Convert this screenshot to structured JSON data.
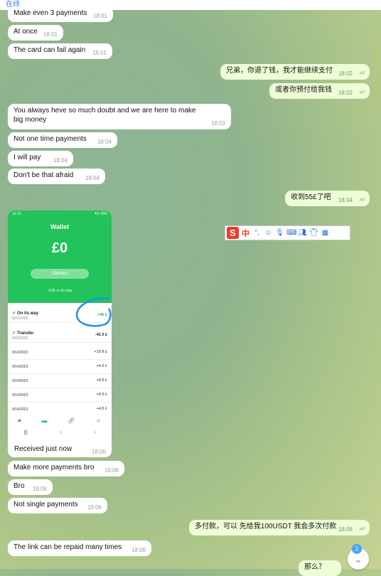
{
  "header": {
    "status": "在线"
  },
  "messages": [
    {
      "text": "Make even 3 payments",
      "time": "18:01"
    },
    {
      "text": "At once",
      "time": "18:01"
    },
    {
      "text": "The card can fail again",
      "time": "18:01"
    },
    {
      "text": "兄弟，你退了钱，我才能继续支付",
      "time": "18:02"
    },
    {
      "text": "或者你预付给我钱",
      "time": "18:02"
    },
    {
      "text": "You always heve so much doubt and we are here to make big money",
      "time": "18:03"
    },
    {
      "text": "Not one time payments",
      "time": "18:04"
    },
    {
      "text": "I will pay",
      "time": "18:04"
    },
    {
      "text": "Don't be that afraid",
      "time": "18:04"
    },
    {
      "text": "收到55£了吧",
      "time": "18.04"
    },
    {
      "text": "Received just now",
      "time": "18:06"
    },
    {
      "text": "Make more payments bro",
      "time": "18:06"
    },
    {
      "text": "Bro",
      "time": "18:06"
    },
    {
      "text": "Not single payments",
      "time": "18:06"
    },
    {
      "text": "多付款，可以 先给我100USDT 我会多次付款",
      "time": "18:06"
    },
    {
      "text": "The link can be repaid many times",
      "time": "18:06"
    },
    {
      "text": "那么？"
    }
  ],
  "photo": {
    "status_left": "12:13",
    "status_right": "4G 43%",
    "title": "Wallet",
    "balance": "£0",
    "cashout": "Cashout",
    "on_its_way": "+£45 on its way",
    "transactions": [
      {
        "name": "On its way",
        "date": "9/21/2023",
        "amount": "+45 £"
      },
      {
        "name": "Transfer",
        "date": "9/15/2023",
        "amount": "-42.3 £"
      },
      {
        "date": "9/14/2023",
        "amount": "+19.8 £"
      },
      {
        "date": "9/14/2023",
        "amount": "+4.5 £"
      },
      {
        "date": "9/14/2023",
        "amount": "+4.5 £"
      },
      {
        "date": "9/14/2023",
        "amount": "+4.5 £"
      },
      {
        "date": "9/14/2023",
        "amount": "+4.5 £"
      },
      {
        "date": "9/14/2023",
        "amount": "+4.5 £"
      }
    ]
  },
  "ime": {
    "logo": "S",
    "mode": "中",
    "punct": "°,"
  },
  "scroll": {
    "badge": "1"
  },
  "colors": {
    "incoming": "#ffffff",
    "outgoing": "#eefed6",
    "accent": "#21c35a"
  }
}
